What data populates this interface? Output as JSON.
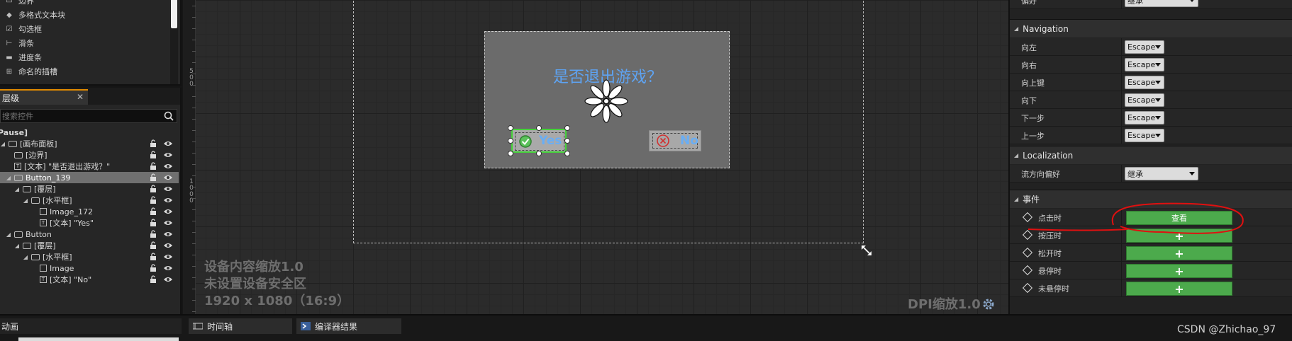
{
  "palette": {
    "items": [
      {
        "label": "边界",
        "icon": "border-icon"
      },
      {
        "label": "多格式文本块",
        "icon": "rich-text-icon"
      },
      {
        "label": "勾选框",
        "icon": "checkbox-icon"
      },
      {
        "label": "滑条",
        "icon": "slider-icon"
      },
      {
        "label": "进度条",
        "icon": "progress-bar-icon"
      },
      {
        "label": "命名的插槽",
        "icon": "named-slot-icon"
      }
    ]
  },
  "hierarchy": {
    "tab_label": "层级",
    "search_placeholder": "搜索控件",
    "root_label": "[Pause]",
    "rows": [
      {
        "label": "[画布面板]",
        "indent": 0,
        "icon": "canvas-icon",
        "selected": false
      },
      {
        "label": "[边界]",
        "indent": 1,
        "icon": "border-icon",
        "selected": false
      },
      {
        "label": "[文本] \"是否退出游戏？\"",
        "indent": 1,
        "icon": "text-icon",
        "selected": false
      },
      {
        "label": "Button_139",
        "indent": 1,
        "icon": "button-icon",
        "selected": true
      },
      {
        "label": "[覆层]",
        "indent": 2,
        "icon": "overlay-icon",
        "selected": false
      },
      {
        "label": "[水平框]",
        "indent": 3,
        "icon": "horizontal-box-icon",
        "selected": false
      },
      {
        "label": "Image_172",
        "indent": 4,
        "icon": "image-icon",
        "selected": false
      },
      {
        "label": "[文本] \"Yes\"",
        "indent": 4,
        "icon": "text-icon",
        "selected": false
      },
      {
        "label": "Button",
        "indent": 1,
        "icon": "button-icon",
        "selected": false
      },
      {
        "label": "[覆层]",
        "indent": 2,
        "icon": "overlay-icon",
        "selected": false
      },
      {
        "label": "[水平框]",
        "indent": 3,
        "icon": "horizontal-box-icon",
        "selected": false
      },
      {
        "label": "Image",
        "indent": 4,
        "icon": "image-icon",
        "selected": false
      },
      {
        "label": "[文本] \"No\"",
        "indent": 4,
        "icon": "text-icon",
        "selected": false
      }
    ]
  },
  "viewport": {
    "ruler_top_digits": [
      "5",
      "0",
      "0"
    ],
    "ruler_bottom_digits": [
      "1",
      "0",
      "0",
      "0"
    ],
    "dialog_title": "是否退出游戏？",
    "yes_label": "Yes",
    "no_label": "No",
    "info_lines": [
      "设备内容缩放1.0",
      "未设置设备安全区",
      "1920 x 1080（16:9）"
    ],
    "dpi_label": "DPI缩放1.0",
    "colors": {
      "title": "#5ea3f2",
      "selection": "#45d13a"
    }
  },
  "details": {
    "top_row": {
      "label": "偏好",
      "value": "继承"
    },
    "navigation": {
      "header": "Navigation",
      "rows": [
        {
          "label": "向左",
          "value": "Escape"
        },
        {
          "label": "向右",
          "value": "Escape"
        },
        {
          "label": "向上键",
          "value": "Escape"
        },
        {
          "label": "向下",
          "value": "Escape"
        },
        {
          "label": "下一步",
          "value": "Escape"
        },
        {
          "label": "上一步",
          "value": "Escape"
        }
      ]
    },
    "localization": {
      "header": "Localization",
      "rows": [
        {
          "label": "流方向偏好",
          "value": "继承"
        }
      ]
    },
    "events": {
      "header": "事件",
      "rows": [
        {
          "label": "点击时",
          "button": "查看"
        },
        {
          "label": "按压时",
          "button": "+"
        },
        {
          "label": "松开时",
          "button": "+"
        },
        {
          "label": "悬停时",
          "button": "+"
        },
        {
          "label": "未悬停时",
          "button": "+"
        }
      ]
    }
  },
  "bottom": {
    "anim_tab": "动画",
    "tabs": [
      {
        "label": "时间轴",
        "icon": "timeline-icon"
      },
      {
        "label": "编译器结果",
        "icon": "compiler-icon"
      }
    ],
    "watermark": "CSDN @Zhichao_97"
  }
}
